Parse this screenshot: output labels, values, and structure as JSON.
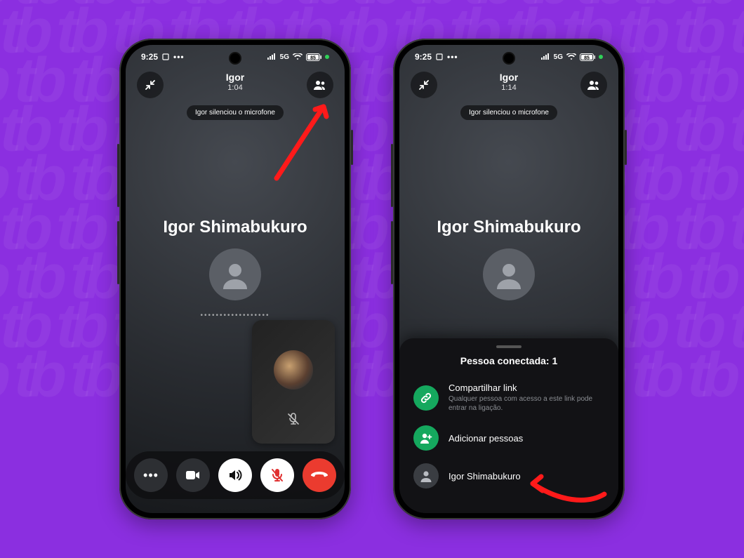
{
  "statusbar": {
    "time": "9:25",
    "network_label": "5G",
    "battery": "85"
  },
  "left": {
    "header_name": "Igor",
    "header_time": "1:04",
    "toast": "Igor silenciou o microfone",
    "caller_name": "Igor Shimabukuro",
    "dots": "••••••••••••••••••"
  },
  "right": {
    "header_name": "Igor",
    "header_time": "1:14",
    "toast": "Igor silenciou o microfone",
    "caller_name": "Igor Shimabukuro"
  },
  "sheet": {
    "title": "Pessoa conectada: 1",
    "share_title": "Compartilhar link",
    "share_sub": "Qualquer pessoa com acesso a este link pode entrar na ligação.",
    "add_title": "Adicionar pessoas",
    "person_name": "Igor Shimabukuro"
  }
}
